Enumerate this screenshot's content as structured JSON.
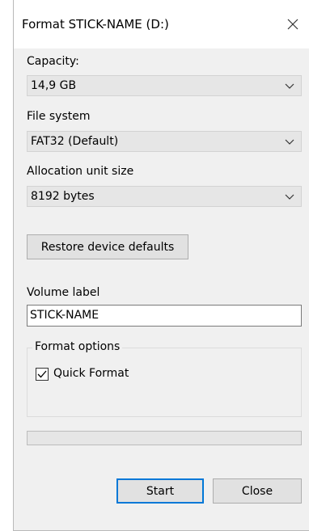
{
  "window": {
    "title": "Format STICK-NAME (D:)",
    "close_icon": "close-icon"
  },
  "capacity": {
    "label": "Capacity:",
    "value": "14,9 GB"
  },
  "file_system": {
    "label": "File system",
    "value": "FAT32 (Default)"
  },
  "allocation": {
    "label": "Allocation unit size",
    "value": "8192 bytes"
  },
  "restore_button": {
    "label": "Restore device defaults"
  },
  "volume": {
    "label": "Volume label",
    "value": "STICK-NAME"
  },
  "format_options": {
    "title": "Format options",
    "quick_format_label": "Quick Format",
    "quick_format_checked": true
  },
  "progress": {
    "fraction": 0
  },
  "buttons": {
    "start": "Start",
    "close": "Close"
  },
  "colors": {
    "accent": "#0078d7",
    "dialog_bg": "#f0f0f0"
  }
}
